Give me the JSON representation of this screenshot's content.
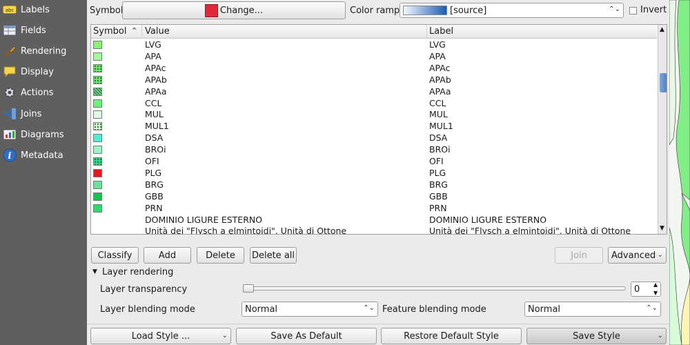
{
  "sidebar": {
    "items": [
      {
        "label": "Labels",
        "icon": "labels-icon"
      },
      {
        "label": "Fields",
        "icon": "fields-icon"
      },
      {
        "label": "Rendering",
        "icon": "rendering-icon"
      },
      {
        "label": "Display",
        "icon": "display-icon"
      },
      {
        "label": "Actions",
        "icon": "actions-icon"
      },
      {
        "label": "Joins",
        "icon": "joins-icon"
      },
      {
        "label": "Diagrams",
        "icon": "diagrams-icon"
      },
      {
        "label": "Metadata",
        "icon": "metadata-icon"
      }
    ]
  },
  "symbol_row": {
    "symbol_label": "Symbol",
    "change_label": "Change...",
    "symbol_color": "#e02a3a",
    "color_ramp_label": "Color ramp",
    "color_ramp_value": "[source]",
    "invert_label": "Invert",
    "invert_checked": false
  },
  "table": {
    "headers": {
      "symbol": "Symbol",
      "value": "Value",
      "label": "Label"
    },
    "rows": [
      {
        "value": "LVG",
        "label": "LVG",
        "color": "#8cf07a",
        "pattern": "solid"
      },
      {
        "value": "APA",
        "label": "APA",
        "color": "#a5f7a0",
        "pattern": "solid"
      },
      {
        "value": "APAc",
        "label": "APAc",
        "color": "#6be66a",
        "pattern": "dots"
      },
      {
        "value": "APAb",
        "label": "APAb",
        "color": "#6be66a",
        "pattern": "dots"
      },
      {
        "value": "APAa",
        "label": "APAa",
        "color": "#6ed98a",
        "pattern": "hatch"
      },
      {
        "value": "CCL",
        "label": "CCL",
        "color": "#6cf27a",
        "pattern": "solid"
      },
      {
        "value": "MUL",
        "label": "MUL",
        "color": "#dcfbe0",
        "pattern": "solid"
      },
      {
        "value": "MUL1",
        "label": "MUL1",
        "color": "#d4f8d4",
        "pattern": "dots"
      },
      {
        "value": "DSA",
        "label": "DSA",
        "color": "#55ead2",
        "pattern": "solid"
      },
      {
        "value": "BROi",
        "label": "BROi",
        "color": "#9ef2c8",
        "pattern": "solid"
      },
      {
        "value": "OFI",
        "label": "OFI",
        "color": "#2fd68a",
        "pattern": "dots"
      },
      {
        "value": "PLG",
        "label": "PLG",
        "color": "#e8141e",
        "pattern": "solid"
      },
      {
        "value": "BRG",
        "label": "BRG",
        "color": "#6fe09a",
        "pattern": "solid"
      },
      {
        "value": "GBB",
        "label": "GBB",
        "color": "#17c24e",
        "pattern": "solid"
      },
      {
        "value": "PRN",
        "label": "PRN",
        "color": "#30d870",
        "pattern": "solid"
      },
      {
        "value": "DOMINIO LIGURE ESTERNO",
        "label": "DOMINIO LIGURE ESTERNO",
        "color": "",
        "pattern": "none"
      },
      {
        "value": "Unità dei \"Flysch a elmintoidi\", Unità di Ottone",
        "label": "Unità dei \"Flysch a elmintoidi\", Unità di Ottone",
        "color": "",
        "pattern": "none"
      }
    ]
  },
  "buttons": {
    "classify": "Classify",
    "add": "Add",
    "delete": "Delete",
    "delete_all": "Delete all",
    "join": "Join",
    "advanced": "Advanced"
  },
  "layer_rendering": {
    "title": "Layer rendering",
    "transparency_label": "Layer transparency",
    "transparency_value": "0",
    "blending_label": "Layer blending mode",
    "blending_value": "Normal",
    "feature_blending_label": "Feature blending mode",
    "feature_blending_value": "Normal"
  },
  "style_buttons": {
    "load_style": "Load Style ...",
    "save_default": "Save As Default",
    "restore_default": "Restore Default Style",
    "save_style": "Save Style"
  }
}
